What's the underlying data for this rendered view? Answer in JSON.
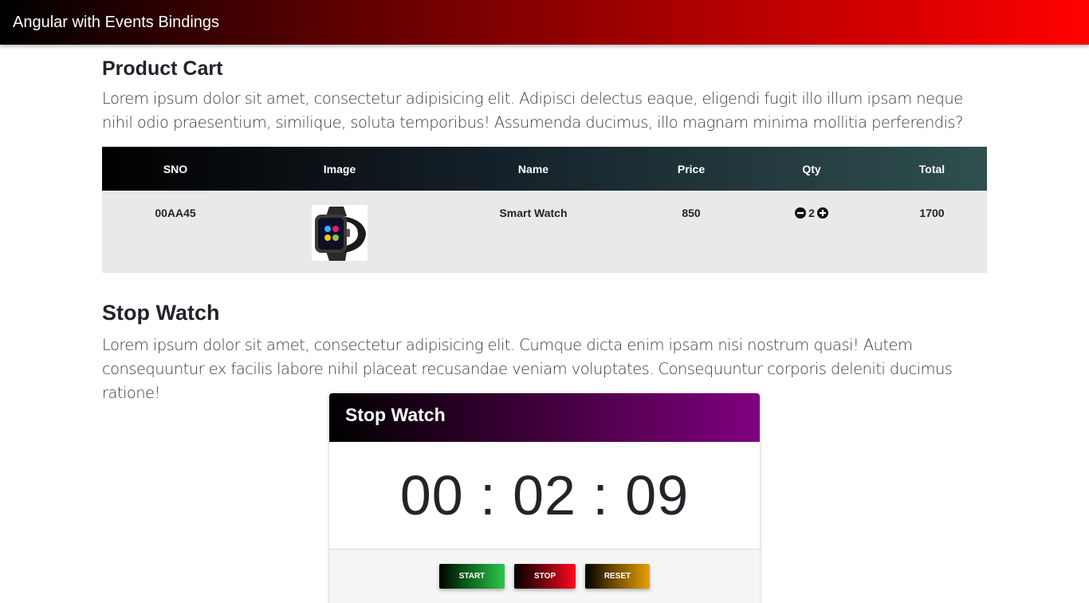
{
  "navbar": {
    "brand": "Angular with Events Bindings"
  },
  "cart": {
    "title": "Product Cart",
    "description": "Lorem ipsum dolor sit amet, consectetur adipisicing elit. Adipisci delectus eaque, eligendi fugit illo illum ipsam neque nihil odio praesentium, similique, soluta temporibus! Assumenda ducimus, illo magnam minima mollitia perferendis?",
    "columns": [
      "SNO",
      "Image",
      "Name",
      "Price",
      "Qty",
      "Total"
    ],
    "rows": [
      {
        "sno": "00AA45",
        "image": "smart-watch",
        "name": "Smart Watch",
        "price": "850",
        "qty": "2",
        "total": "1700"
      }
    ]
  },
  "stopwatch": {
    "title": "Stop Watch",
    "description": "Lorem ipsum dolor sit amet, consectetur adipisicing elit. Cumque dicta enim ipsam nisi nostrum quasi! Autem consequuntur ex facilis labore nihil placeat recusandae veniam voluptates. Consequuntur corporis deleniti ducimus ratione!",
    "card_title": "Stop Watch",
    "time": "00 : 02 : 09",
    "buttons": {
      "start": "START",
      "stop": "STOP",
      "reset": "RESET"
    }
  },
  "colors": {
    "navbar_gradient_end": "#ff0000",
    "table_header_end": "#2f4f4f",
    "stopwatch_header_end": "#800080",
    "start_button": "#2ec44a",
    "stop_button": "#ff0a1e",
    "reset_button": "#e8a000"
  }
}
